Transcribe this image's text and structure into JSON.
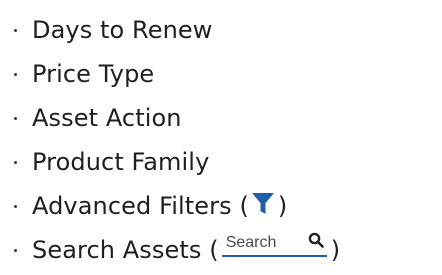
{
  "list": {
    "items": [
      {
        "label": "Days to Renew"
      },
      {
        "label": "Price Type"
      },
      {
        "label": "Asset Action"
      },
      {
        "label": "Product Family"
      },
      {
        "label": "Advanced Filters (",
        "close": ")",
        "icon": "filter-funnel-icon"
      },
      {
        "label": "Search Assets (",
        "close": ")",
        "icon": "search-icon"
      }
    ]
  },
  "search": {
    "placeholder": "Search"
  },
  "colors": {
    "text": "#1f1f1f",
    "filter_icon": "#1f5fa8",
    "search_underline": "#1f5fa8",
    "search_icon": "#222222"
  }
}
